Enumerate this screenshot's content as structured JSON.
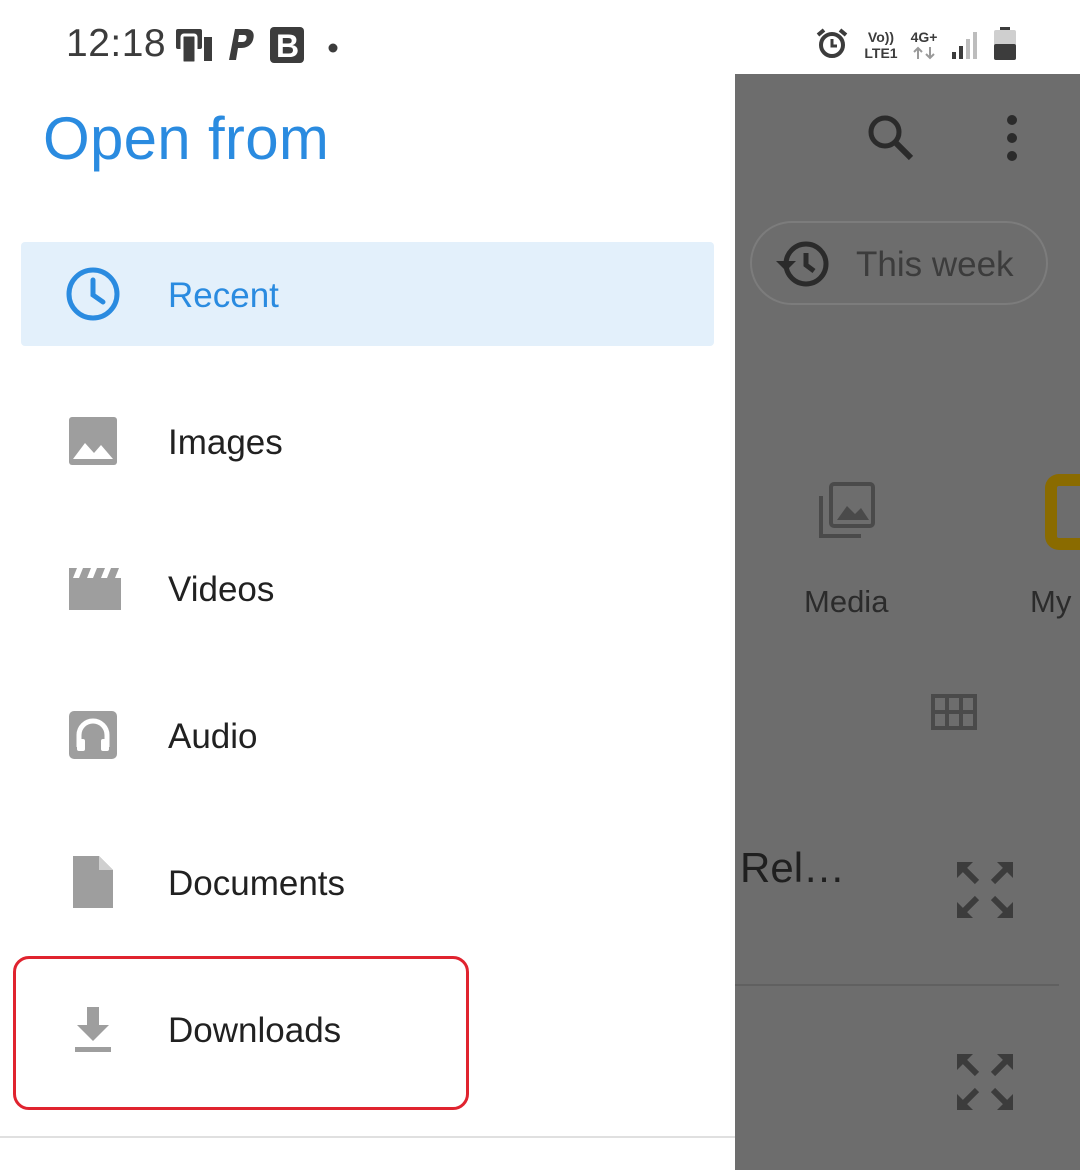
{
  "status_bar": {
    "time": "12:18",
    "network_volte": "Vo))",
    "network_lte": "LTE1",
    "network_type": "4G+",
    "icons": [
      "nfc-icon",
      "paypal-icon",
      "bold-b-icon",
      "dot-icon",
      "alarm-icon",
      "signal-icon",
      "battery-icon"
    ]
  },
  "drawer": {
    "title": "Open from",
    "items": [
      {
        "label": "Recent",
        "icon": "clock-icon",
        "active": true
      },
      {
        "label": "Images",
        "icon": "image-icon",
        "active": false
      },
      {
        "label": "Videos",
        "icon": "clapperboard-icon",
        "active": false
      },
      {
        "label": "Audio",
        "icon": "headphones-icon",
        "active": false
      },
      {
        "label": "Documents",
        "icon": "document-icon",
        "active": false
      },
      {
        "label": "Downloads",
        "icon": "download-icon",
        "active": false
      }
    ]
  },
  "background_app": {
    "chip_label": "This week",
    "media_label": "Media",
    "my_label": "My",
    "recent_truncated": "Rel…"
  },
  "colors": {
    "accent": "#2a8be0",
    "active_bg": "#e3f0fb",
    "icon_gray": "#9e9e9e",
    "scrim": "#6d6d6d",
    "highlight": "#e0232f"
  }
}
